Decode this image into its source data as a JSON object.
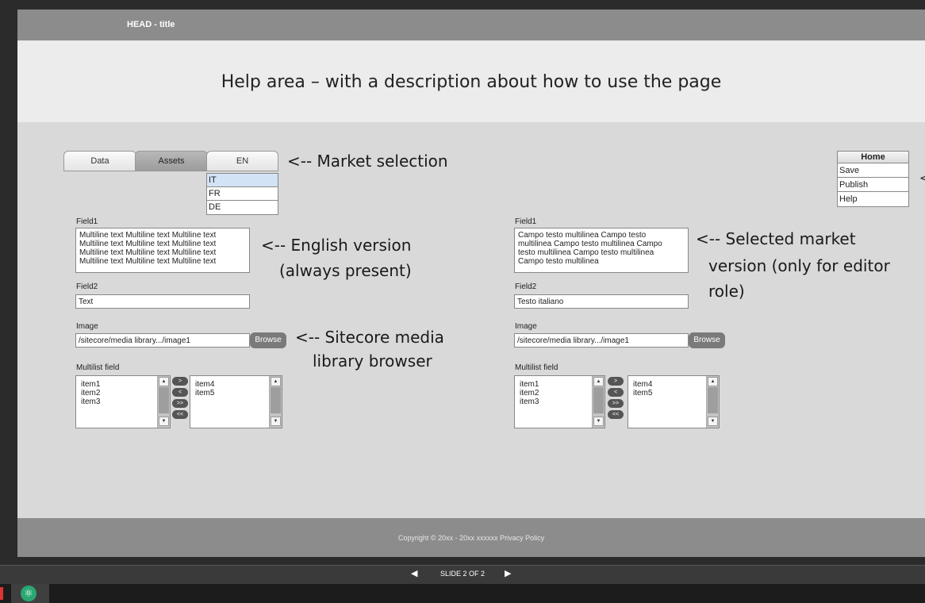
{
  "header": {
    "title": "HEAD - title"
  },
  "help": {
    "text": "Help area – with a description about how to use the page"
  },
  "tabs": [
    {
      "label": "Data"
    },
    {
      "label": "Assets"
    },
    {
      "label": "EN"
    }
  ],
  "languages": {
    "options": [
      "IT",
      "FR",
      "DE"
    ],
    "selected": "IT"
  },
  "annotations": {
    "market": "<-- Market selection",
    "english_1": "<-- English version",
    "english_2": "(always present)",
    "selected_1": "<-- Selected market",
    "selected_2": "version (only for editor",
    "selected_3": "role)",
    "sitecore_1": "<-- Sitecore media",
    "sitecore_2": "library browser",
    "menu_edge": "<"
  },
  "home_menu": {
    "title": "Home",
    "items": [
      "Save",
      "Publish",
      "Help"
    ]
  },
  "form_en": {
    "field1_label": "Field1",
    "field1_lines": [
      "Multiline text Multiline text Multiline text",
      "Multiline text Multiline text Multiline text",
      "Multiline text Multiline text Multiline text",
      "Multiline text Multiline text Multiline text"
    ],
    "field2_label": "Field2",
    "field2_value": "Text",
    "image_label": "Image",
    "image_value": "/sitecore/media library.../image1",
    "browse_label": "Browse",
    "multilist_label": "Multilist field",
    "left_items": [
      "item1",
      "item2",
      "item3"
    ],
    "right_items": [
      "item4",
      "item5"
    ]
  },
  "form_it": {
    "field1_label": "Field1",
    "field1_lines": [
      "Campo testo multilinea Campo testo",
      "multilinea Campo testo multilinea Campo",
      "testo multilinea Campo testo multilinea",
      "Campo testo multilinea"
    ],
    "field2_label": "Field2",
    "field2_value": "Testo italiano",
    "image_label": "Image",
    "image_value": "/sitecore/media library.../image1",
    "browse_label": "Browse",
    "multilist_label": "Multilist field",
    "left_items": [
      "item1",
      "item2",
      "item3"
    ],
    "right_items": [
      "item4",
      "item5"
    ]
  },
  "mover_buttons": [
    ">",
    "<",
    ">>",
    "<<"
  ],
  "footer": {
    "text": "Copyright © 20xx - 20xx xxxxxx  Privacy Policy"
  },
  "presentation": {
    "slide_indicator": "SLIDE 2 OF 2"
  },
  "colors": {
    "head_bar": "#8c8c8c",
    "help_bg": "#ececec",
    "body_bg": "#d9d9d9",
    "lang_selected": "#d3e3f6"
  },
  "icons": {
    "prev": "triangle-left",
    "next": "triangle-right",
    "app": "atom-icon"
  }
}
